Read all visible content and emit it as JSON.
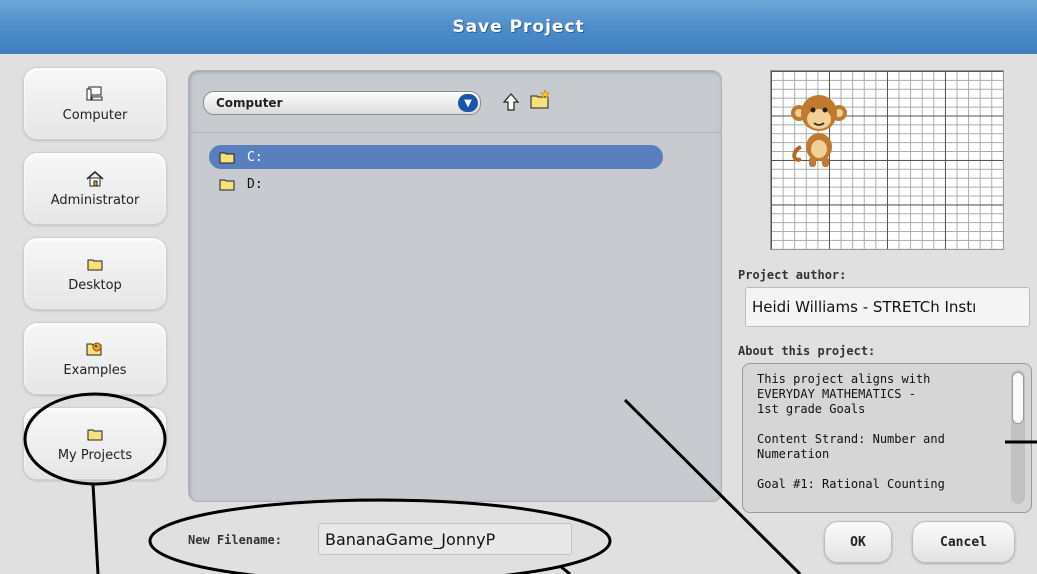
{
  "window": {
    "title": "Save Project"
  },
  "sidebar": {
    "items": [
      {
        "label": "Computer",
        "icon": "computer-icon"
      },
      {
        "label": "Administrator",
        "icon": "home-icon"
      },
      {
        "label": "Desktop",
        "icon": "folder-icon"
      },
      {
        "label": "Examples",
        "icon": "examples-icon"
      },
      {
        "label": "My Projects",
        "icon": "folder-icon"
      }
    ]
  },
  "browser": {
    "location": "Computer",
    "files": [
      {
        "name": "C:",
        "selected": true
      },
      {
        "name": "D:",
        "selected": false
      }
    ]
  },
  "filename": {
    "label": "New Filename:",
    "value": "BananaGame_JonnyP"
  },
  "project": {
    "author_label": "Project author:",
    "author": "Heidi Williams - STRETCh Instı",
    "about_label": "About this project:",
    "about": "This project aligns with\nEVERYDAY MATHEMATICS -\n1st grade Goals\n\nContent Strand: Number and\nNumeration\n\nGoal #1: Rational Counting"
  },
  "buttons": {
    "ok": "OK",
    "cancel": "Cancel"
  },
  "colors": {
    "title_bar": "#4d8dc9",
    "selection": "#5a7fbf",
    "folder": "#f5e27a"
  }
}
